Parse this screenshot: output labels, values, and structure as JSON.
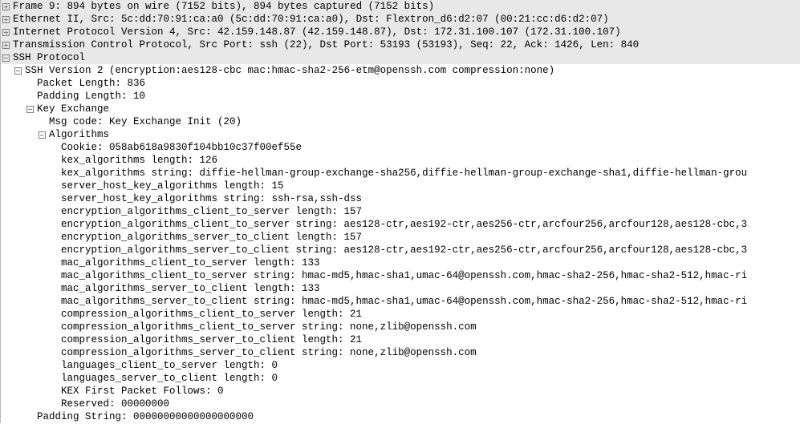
{
  "lines": [
    {
      "kind": "hdr",
      "toggle": "plus",
      "indent": 0,
      "text": "Frame 9: 894 bytes on wire (7152 bits), 894 bytes captured (7152 bits)"
    },
    {
      "kind": "hdr",
      "toggle": "plus",
      "indent": 0,
      "text": "Ethernet II, Src: 5c:dd:70:91:ca:a0 (5c:dd:70:91:ca:a0), Dst: Flextron_d6:d2:07 (00:21:cc:d6:d2:07)"
    },
    {
      "kind": "hdr",
      "toggle": "plus",
      "indent": 0,
      "text": "Internet Protocol Version 4, Src: 42.159.148.87 (42.159.148.87), Dst: 172.31.100.107 (172.31.100.107)"
    },
    {
      "kind": "hdr",
      "toggle": "plus",
      "indent": 0,
      "text": "Transmission Control Protocol, Src Port: ssh (22), Dst Port: 53193 (53193), Seq: 22, Ack: 1426, Len: 840"
    },
    {
      "kind": "hdr",
      "toggle": "minus",
      "indent": 0,
      "text": "SSH Protocol"
    },
    {
      "kind": "body",
      "toggle": "minus",
      "indent": 1,
      "text": "SSH Version 2 (encryption:aes128-cbc mac:hmac-sha2-256-etm@openssh.com compression:none)"
    },
    {
      "kind": "body",
      "toggle": null,
      "indent": 2,
      "text": "Packet Length: 836"
    },
    {
      "kind": "body",
      "toggle": null,
      "indent": 2,
      "text": "Padding Length: 10"
    },
    {
      "kind": "body",
      "toggle": "minus",
      "indent": 2,
      "text": "Key Exchange"
    },
    {
      "kind": "body",
      "toggle": null,
      "indent": 3,
      "text": "Msg code: Key Exchange Init (20)"
    },
    {
      "kind": "body",
      "toggle": "minus",
      "indent": 3,
      "text": "Algorithms"
    },
    {
      "kind": "body",
      "toggle": null,
      "indent": 4,
      "text": "Cookie: 058ab618a9830f104bb10c37f00ef55e"
    },
    {
      "kind": "body",
      "toggle": null,
      "indent": 4,
      "text": "kex_algorithms length: 126"
    },
    {
      "kind": "body",
      "toggle": null,
      "indent": 4,
      "text": "kex_algorithms string: diffie-hellman-group-exchange-sha256,diffie-hellman-group-exchange-sha1,diffie-hellman-grou"
    },
    {
      "kind": "body",
      "toggle": null,
      "indent": 4,
      "text": "server_host_key_algorithms length: 15"
    },
    {
      "kind": "body",
      "toggle": null,
      "indent": 4,
      "text": "server_host_key_algorithms string: ssh-rsa,ssh-dss"
    },
    {
      "kind": "body",
      "toggle": null,
      "indent": 4,
      "text": "encryption_algorithms_client_to_server length: 157"
    },
    {
      "kind": "body",
      "toggle": null,
      "indent": 4,
      "text": "encryption_algorithms_client_to_server string: aes128-ctr,aes192-ctr,aes256-ctr,arcfour256,arcfour128,aes128-cbc,3"
    },
    {
      "kind": "body",
      "toggle": null,
      "indent": 4,
      "text": "encryption_algorithms_server_to_client length: 157"
    },
    {
      "kind": "body",
      "toggle": null,
      "indent": 4,
      "text": "encryption_algorithms_server_to_client string: aes128-ctr,aes192-ctr,aes256-ctr,arcfour256,arcfour128,aes128-cbc,3"
    },
    {
      "kind": "body",
      "toggle": null,
      "indent": 4,
      "text": "mac_algorithms_client_to_server length: 133"
    },
    {
      "kind": "body",
      "toggle": null,
      "indent": 4,
      "text": "mac_algorithms_client_to_server string: hmac-md5,hmac-sha1,umac-64@openssh.com,hmac-sha2-256,hmac-sha2-512,hmac-ri"
    },
    {
      "kind": "body",
      "toggle": null,
      "indent": 4,
      "text": "mac_algorithms_server_to_client length: 133"
    },
    {
      "kind": "body",
      "toggle": null,
      "indent": 4,
      "text": "mac_algorithms_server_to_client string: hmac-md5,hmac-sha1,umac-64@openssh.com,hmac-sha2-256,hmac-sha2-512,hmac-ri"
    },
    {
      "kind": "body",
      "toggle": null,
      "indent": 4,
      "text": "compression_algorithms_client_to_server length: 21"
    },
    {
      "kind": "body",
      "toggle": null,
      "indent": 4,
      "text": "compression_algorithms_client_to_server string: none,zlib@openssh.com"
    },
    {
      "kind": "body",
      "toggle": null,
      "indent": 4,
      "text": "compression_algorithms_server_to_client length: 21"
    },
    {
      "kind": "body",
      "toggle": null,
      "indent": 4,
      "text": "compression_algorithms_server_to_client string: none,zlib@openssh.com"
    },
    {
      "kind": "body",
      "toggle": null,
      "indent": 4,
      "text": "languages_client_to_server length: 0"
    },
    {
      "kind": "body",
      "toggle": null,
      "indent": 4,
      "text": "languages_server_to_client length: 0"
    },
    {
      "kind": "body",
      "toggle": null,
      "indent": 4,
      "text": "KEX First Packet Follows: 0"
    },
    {
      "kind": "body",
      "toggle": null,
      "indent": 4,
      "text": "Reserved: 00000000"
    },
    {
      "kind": "body",
      "toggle": null,
      "indent": 2,
      "text": "Padding String: 00000000000000000000"
    }
  ]
}
